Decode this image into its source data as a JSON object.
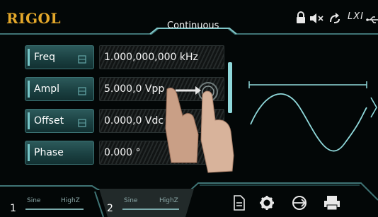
{
  "header": {
    "brand": "RIGOL",
    "mode": "Continuous",
    "lxi_label": "LXI",
    "icons": [
      "lock-icon",
      "mute-icon",
      "sync-icon",
      "lxi-icon",
      "usb-icon"
    ]
  },
  "params": [
    {
      "label": "Freq",
      "value": "1.000,000,000 kHz",
      "linked": true
    },
    {
      "label": "Ampl",
      "value": "5.000,0 Vpp",
      "linked": true
    },
    {
      "label": "Offset",
      "value": "0.000,0 Vdc",
      "linked": true
    },
    {
      "label": "Phase",
      "value": "0.000 °",
      "linked": false
    }
  ],
  "waveform": {
    "type": "sine",
    "cycles": 1
  },
  "channels": [
    {
      "number": "1",
      "wave": "Sine",
      "load": "HighZ"
    },
    {
      "number": "2",
      "wave": "Sine",
      "load": "HighZ"
    }
  ],
  "menu": {
    "icons": [
      "store-icon",
      "utility-icon",
      "sync-channels-icon",
      "print-icon"
    ]
  },
  "colors": {
    "accent": "#8fd8da",
    "brand": "#e3a72a",
    "button_fill": "#1b4142",
    "background": "#030707"
  }
}
